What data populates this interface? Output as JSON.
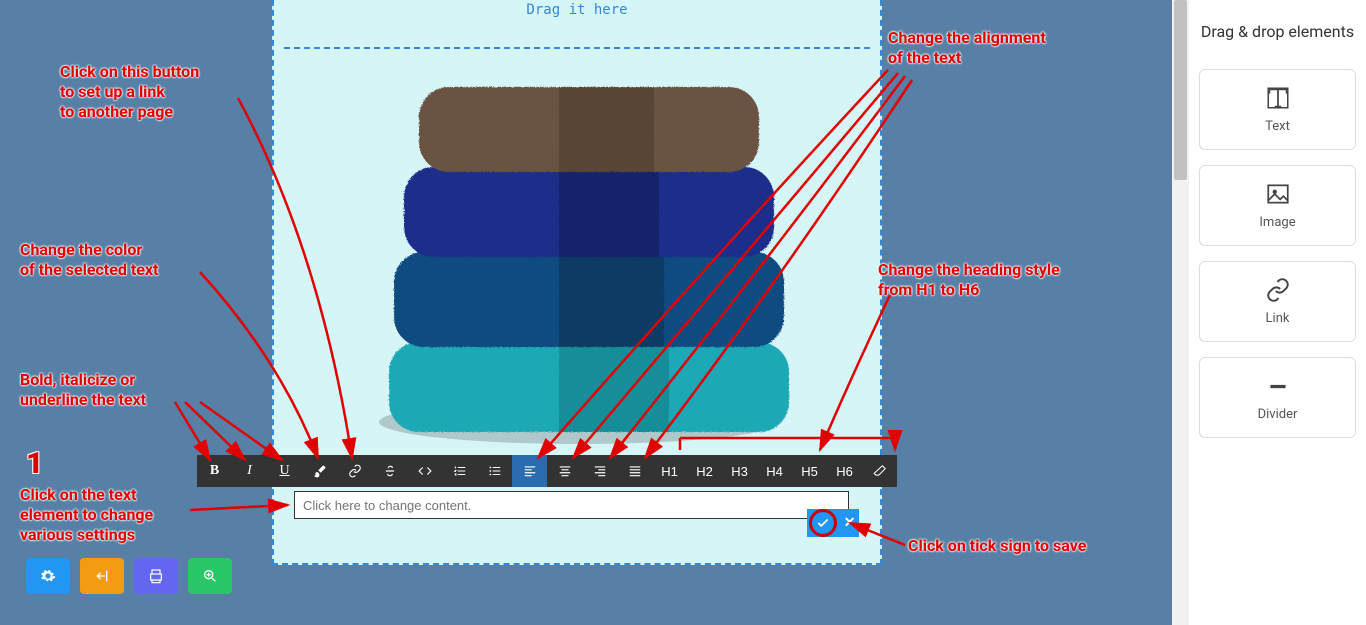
{
  "canvas": {
    "drag_text": "Drag it here"
  },
  "toolbar": {
    "bold": "B",
    "italic": "I",
    "underline": "U",
    "h1": "H1",
    "h2": "H2",
    "h3": "H3",
    "h4": "H4",
    "h5": "H5",
    "h6": "H6"
  },
  "textedit": {
    "placeholder": "Click here to change content."
  },
  "sidebar": {
    "title": "Drag & drop elements",
    "items": [
      {
        "label": "Text"
      },
      {
        "label": "Image"
      },
      {
        "label": "Link"
      },
      {
        "label": "Divider"
      }
    ]
  },
  "annotations": {
    "step_number": "1",
    "link": "Click on this button\nto set up a link\nto another page",
    "color": "Change the color\nof the selected text",
    "biu": "Bold, italicize or\nunderline the text",
    "click_text": "Click on the text\nelement to change\nvarious settings",
    "align": "Change the alignment\nof the text",
    "heading": "Change the heading style\nfrom H1 to H6",
    "save": "Click on tick sign to save"
  }
}
